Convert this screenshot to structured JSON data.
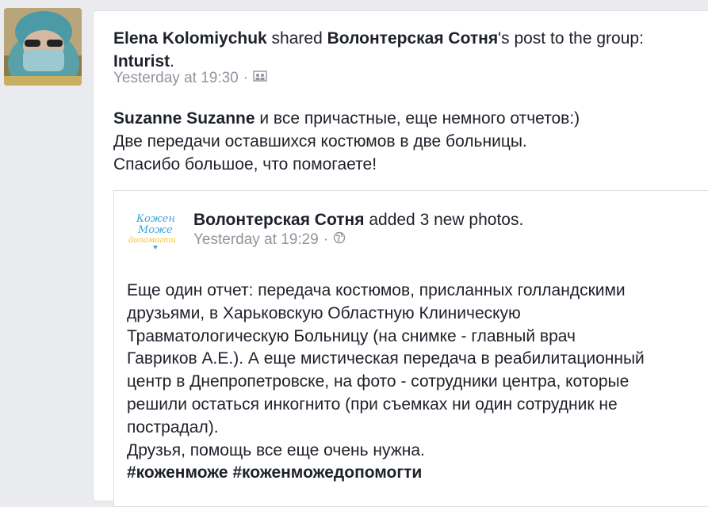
{
  "post": {
    "author": "Elena Kolomiychuk",
    "action": " shared ",
    "source_page": "Волонтерская Сотня",
    "action_suffix": "'s post to the group:",
    "group": "Inturist",
    "group_suffix": ".",
    "timestamp": "Yesterday at 19:30",
    "separator": "·",
    "audience_icon": "group-audience-icon",
    "mention": "Suzanne Suzanne",
    "text_line1_rest": " и все причастные, еще немного отчетов:)",
    "text_line2": "Две передачи оставшихся костюмов в две больницы.",
    "text_line3": "Спасибо большое, что помогаете!"
  },
  "shared_post": {
    "page_name": "Волонтерская Сотня",
    "action": " added 3 new photos.",
    "timestamp": "Yesterday at 19:29",
    "separator": "·",
    "audience_icon": "globe-icon",
    "logo_text": [
      "Кожен",
      "Може",
      "допомогти"
    ],
    "lines": [
      "Еще один отчет: передача костюмов, присланных голландскими",
      "друзьями, в Харьковскую Областную Клиническую",
      "Травматологическую Больницу (на снимке - главный врач",
      "Гавриков А.Е.). А еще мистическая передача в реабилитационный",
      "центр в Днепропетровске, на фото - сотрудники центра, которые",
      "решили остаться инкогнито (при съемках ни один сотрудник не",
      "пострадал).",
      "Друзья, помощь все еще очень нужна."
    ],
    "hashtags": "#коженможе #коженможедопомогти"
  },
  "colors": {
    "background": "#e9ebee",
    "text": "#1d2129",
    "meta": "#90949c",
    "logo_blue": "#3aa6d8",
    "logo_yellow": "#f2c230"
  }
}
